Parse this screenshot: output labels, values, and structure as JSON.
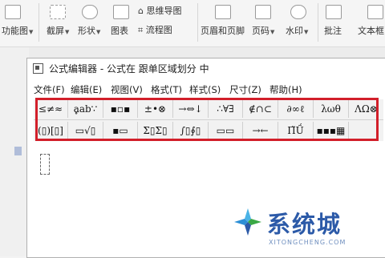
{
  "ribbon": {
    "items": [
      {
        "label": "功能图",
        "caret": true
      },
      {
        "label": "截屏",
        "caret": true
      },
      {
        "label": "形状",
        "caret": true
      },
      {
        "label": "图表"
      },
      {
        "label": "思维导图"
      },
      {
        "label": "流程图"
      },
      {
        "label": "页眉和页脚"
      },
      {
        "label": "页码",
        "caret": true
      },
      {
        "label": "水印",
        "caret": true
      },
      {
        "label": "批注"
      },
      {
        "label": "文本框"
      }
    ]
  },
  "editor": {
    "title": "公式编辑器 - 公式在 跟单区域划分 中",
    "menus": [
      "文件(F)",
      "编辑(E)",
      "视图(V)",
      "格式(T)",
      "样式(S)",
      "尺寸(Z)",
      "帮助(H)"
    ],
    "toolbar_row1": [
      "≤≠≈",
      "ḁab∵",
      "▪▫▪",
      "±•⊗",
      "→⇔↓",
      "∴∀∃",
      "∉∩⊂",
      "∂∞ℓ",
      "λωθ",
      "ΛΩ⊗"
    ],
    "toolbar_row2": [
      "(▯)[▯]",
      "▭√▯",
      "▪▭",
      "Σ▯Σ▯",
      "∫▯∮▯",
      "▭▭",
      "→←",
      "Π̃Ṹ",
      "▪▪▪▦"
    ]
  },
  "watermark": {
    "text": "系统城",
    "url": "XITONGCHENG.COM",
    "colors": {
      "blue": "#2c5aa8",
      "green": "#3aa845",
      "lightblue": "#4ab3e6"
    }
  },
  "highlight_color": "#d21f2a"
}
